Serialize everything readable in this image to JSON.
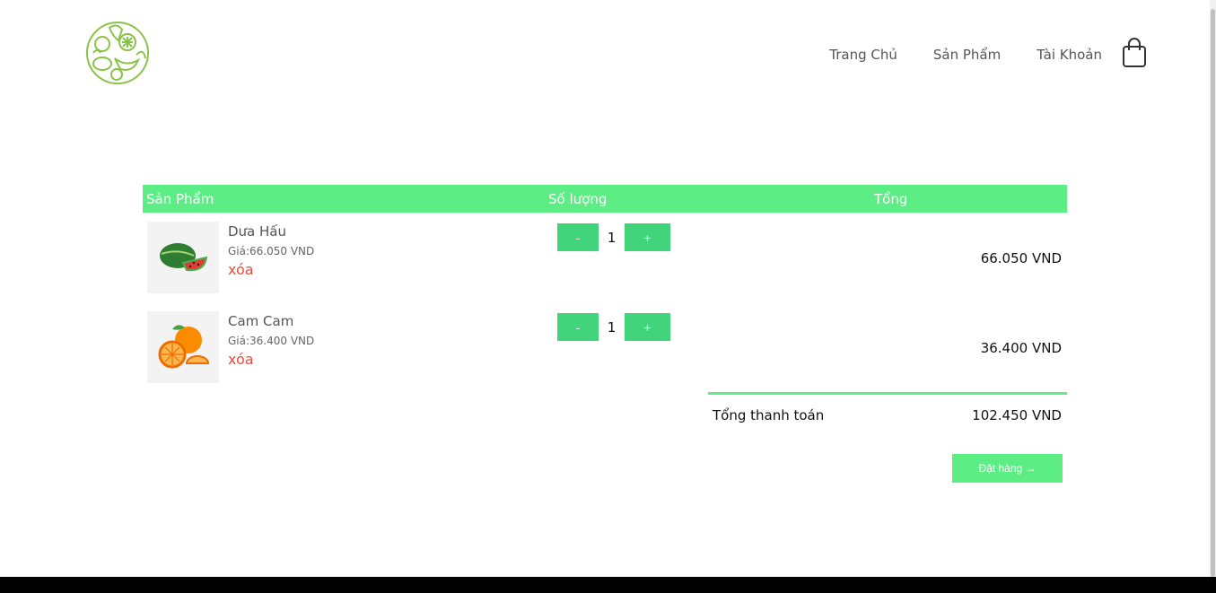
{
  "nav": {
    "items": [
      {
        "label": "Trang Chủ"
      },
      {
        "label": "Sản Phẩm"
      },
      {
        "label": "Tài Khoản"
      }
    ]
  },
  "table": {
    "headers": {
      "product": "Sản Phẩm",
      "quantity": "Số lượng",
      "total": "Tổng"
    },
    "rows": [
      {
        "name": "Dưa Hấu",
        "price": "Giá:66.050 VND",
        "remove": "xóa",
        "minus": "-",
        "quantity": "1",
        "plus": "+",
        "total": "66.050 VND",
        "image_icon": "watermelon-icon"
      },
      {
        "name": "Cam Cam",
        "price": "Giá:36.400 VND",
        "remove": "xóa",
        "minus": "-",
        "quantity": "1",
        "plus": "+",
        "total": "36.400 VND",
        "image_icon": "orange-icon"
      }
    ]
  },
  "summary": {
    "label": "Tổng thanh toán",
    "value": "102.450 VND"
  },
  "order_button": "Đặt hàng →",
  "colors": {
    "accent": "#5ded85",
    "button": "#42d47a",
    "remove": "#e74c3c"
  }
}
